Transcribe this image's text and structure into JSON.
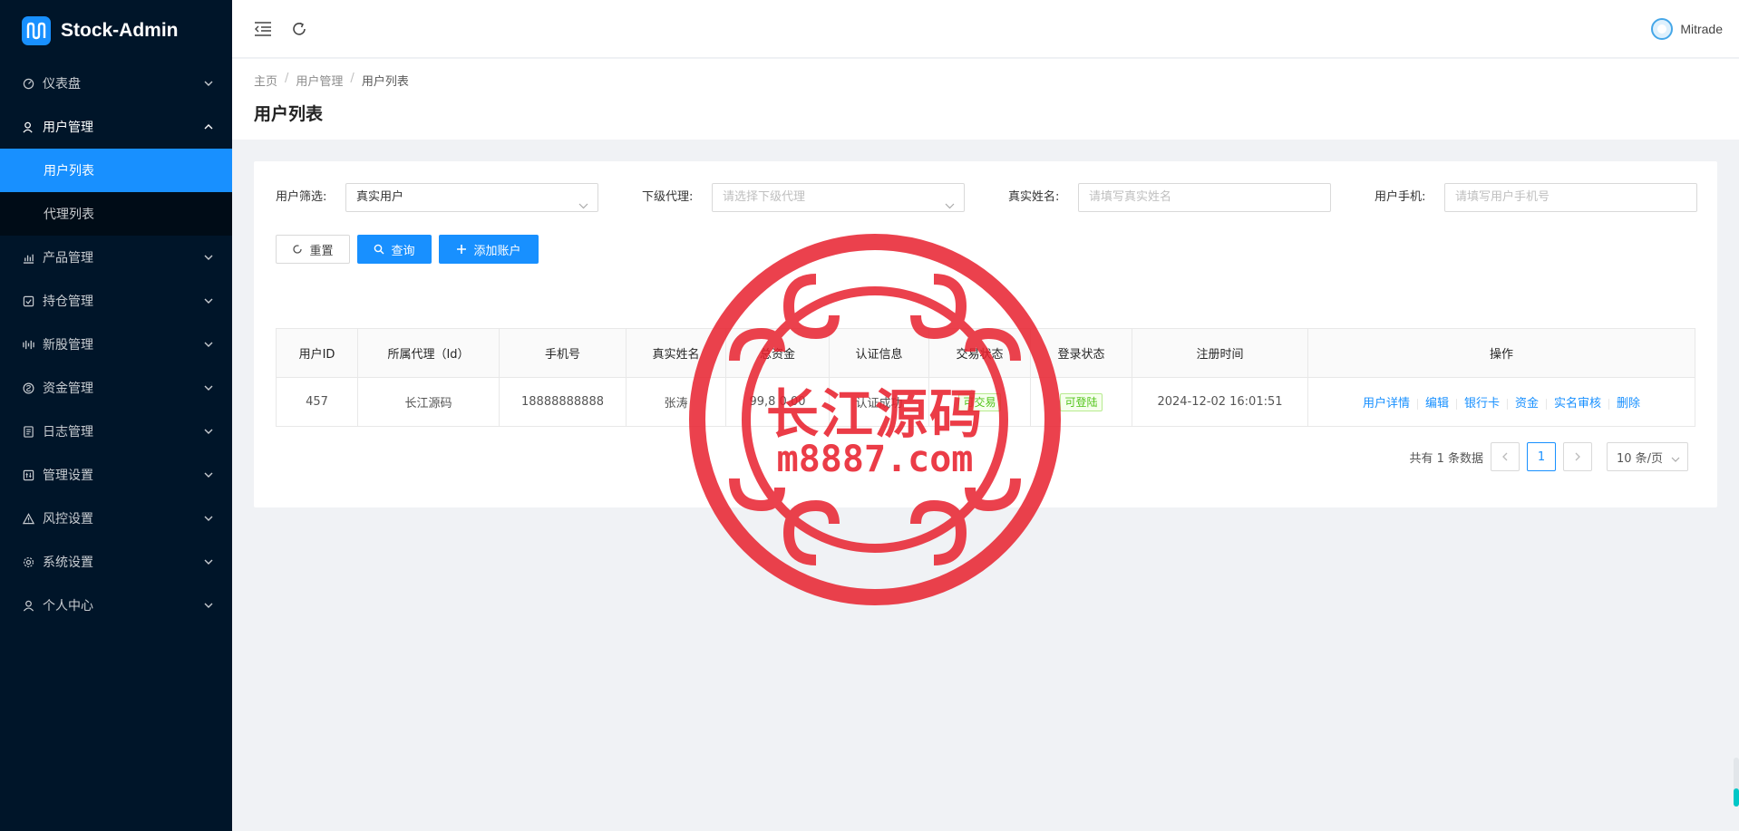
{
  "app": {
    "name": "Stock-Admin"
  },
  "sidebar": {
    "items": [
      {
        "label": "仪表盘",
        "icon": "dashboard-icon"
      },
      {
        "label": "用户管理",
        "icon": "user-manage-icon",
        "open": true,
        "children": [
          {
            "label": "用户列表",
            "active": true
          },
          {
            "label": "代理列表"
          }
        ]
      },
      {
        "label": "产品管理",
        "icon": "bar-chart-icon"
      },
      {
        "label": "持仓管理",
        "icon": "position-icon"
      },
      {
        "label": "新股管理",
        "icon": "ipo-icon"
      },
      {
        "label": "资金管理",
        "icon": "money-icon"
      },
      {
        "label": "日志管理",
        "icon": "log-icon"
      },
      {
        "label": "管理设置",
        "icon": "admin-settings-icon"
      },
      {
        "label": "风控设置",
        "icon": "warning-icon"
      },
      {
        "label": "系统设置",
        "icon": "gear-icon"
      },
      {
        "label": "个人中心",
        "icon": "person-icon"
      }
    ]
  },
  "header": {
    "user": "Mitrade"
  },
  "breadcrumb": [
    "主页",
    "用户管理",
    "用户列表"
  ],
  "page_title": "用户列表",
  "filters": {
    "user_filter": {
      "label": "用户筛选:",
      "value": "真实用户"
    },
    "sub_agent": {
      "label": "下级代理:",
      "placeholder": "请选择下级代理"
    },
    "real_name": {
      "label": "真实姓名:",
      "placeholder": "请填写真实姓名"
    },
    "phone": {
      "label": "用户手机:",
      "placeholder": "请填写用户手机号"
    }
  },
  "buttons": {
    "reset": "重置",
    "search": "查询",
    "add": "添加账户"
  },
  "table": {
    "columns": [
      "用户ID",
      "所属代理（Id）",
      "手机号",
      "真实姓名",
      "总资金",
      "认证信息",
      "交易状态",
      "登录状态",
      "注册时间",
      "操作"
    ],
    "rows": [
      {
        "id": "457",
        "agent": "长江源码",
        "phone": "18888888888",
        "name": "张涛",
        "funds": "99,8 0.00",
        "auth": "认证成功",
        "trade": "可交易",
        "login": "可登陆",
        "reg_time": "2024-12-02 16:01:51"
      }
    ],
    "actions": [
      "用户详情",
      "编辑",
      "银行卡",
      "资金",
      "实名审核",
      "删除"
    ]
  },
  "pagination": {
    "total": "共有 1 条数据",
    "current": "1",
    "page_size": "10 条/页"
  },
  "watermark": {
    "text": "长江源码",
    "site": "m8887.com",
    "color": "#e8212e"
  },
  "colors": {
    "primary": "#1890ff",
    "sidebar_bg": "#001529",
    "submenu_bg": "#000c17"
  }
}
